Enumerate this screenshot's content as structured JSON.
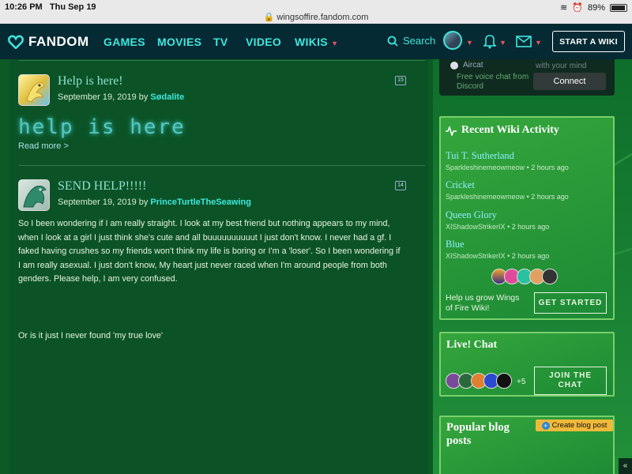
{
  "status": {
    "time": "10:26 PM",
    "date": "Thu Sep 19",
    "url": "wingsoffire.fandom.com",
    "battery": "89%"
  },
  "nav": {
    "logo": "FANDOM",
    "links": [
      "GAMES",
      "MOVIES",
      "TV",
      "VIDEO",
      "WIKIS"
    ],
    "search": "Search",
    "start_wiki": "START A WIKI"
  },
  "posts": [
    {
      "title": "Help is here!",
      "date": "September 19, 2019 by",
      "author": "Sødalite",
      "comments": "15",
      "big_text": "help is here",
      "read_more": "Read more >"
    },
    {
      "title": "SEND HELP!!!!!",
      "date": "September 19, 2019 by",
      "author": "PrinceTurtleTheSeawing",
      "comments": "14",
      "body_lines": [
        "So I been wondering if I am really straight. I look at my best friend but nothing appears to my mind,",
        "when I look at a girl I just think she's cute and all buuuuuuuuuut I just don't know. I never had a gf. I",
        "faked having crushes so my friends won't think my life is boring or I'm a 'loser'. So I been wondering if",
        "I am really asexual. I just don't know, My heart just never raced when I'm around people from both",
        "genders. Please help, I am very confused."
      ],
      "body_end": "Or is it just I never found 'my true love'"
    }
  ],
  "discord": {
    "user": "Aircat",
    "text_right": "with your mind",
    "line1": "Free voice chat from",
    "line2": "Discord",
    "connect": "Connect"
  },
  "activity": {
    "title": "Recent Wiki Activity",
    "items": [
      {
        "page": "Tui T. Sutherland",
        "user": "Sparkleshinemeowmeow",
        "time": "• 2 hours ago"
      },
      {
        "page": "Cricket",
        "user": "Sparkleshinemeowmeow",
        "time": "• 2 hours ago"
      },
      {
        "page": "Queen Glory",
        "user": "XIShadowStrikerIX",
        "time": "• 2 hours ago"
      },
      {
        "page": "Blue",
        "user": "XIShadowStrikerIX",
        "time": "• 2 hours ago"
      }
    ],
    "help_line1": "Help us grow Wings",
    "help_line2": "of Fire Wiki!",
    "get_started": "GET STARTED"
  },
  "chat": {
    "title": "Live! Chat",
    "more": "+5",
    "join_line1": "JOIN THE",
    "join_line2": "CHAT"
  },
  "popular": {
    "title_line1": "Popular blog",
    "title_line2": "posts",
    "create": "Create blog post"
  },
  "colors": {
    "nav_bg": "#062a34",
    "accent": "#3fe6dc",
    "page_bg": "#0d5a26",
    "panel": "#2a9a3a"
  }
}
